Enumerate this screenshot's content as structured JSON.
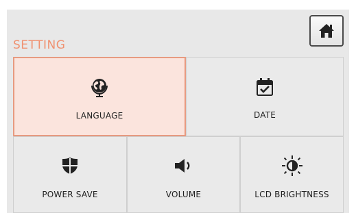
{
  "header": {
    "title": "SETTING",
    "home_icon": "home-icon"
  },
  "menu": {
    "language": {
      "label": "LANGUAGE",
      "icon": "globe-icon",
      "selected": true
    },
    "date": {
      "label": "DATE",
      "icon": "calendar-check-icon"
    },
    "power_save": {
      "label": "POWER SAVE",
      "icon": "shield-icon"
    },
    "volume": {
      "label": "VOLUME",
      "icon": "speaker-icon"
    },
    "lcd_brightness": {
      "label": "LCD BRIGHTNESS",
      "icon": "brightness-icon"
    }
  },
  "colors": {
    "title": "#f09170",
    "selected_fill": "#fbe4dd",
    "selected_border": "#e79a80",
    "tile": "#eaeaea",
    "icon": "#222222"
  }
}
